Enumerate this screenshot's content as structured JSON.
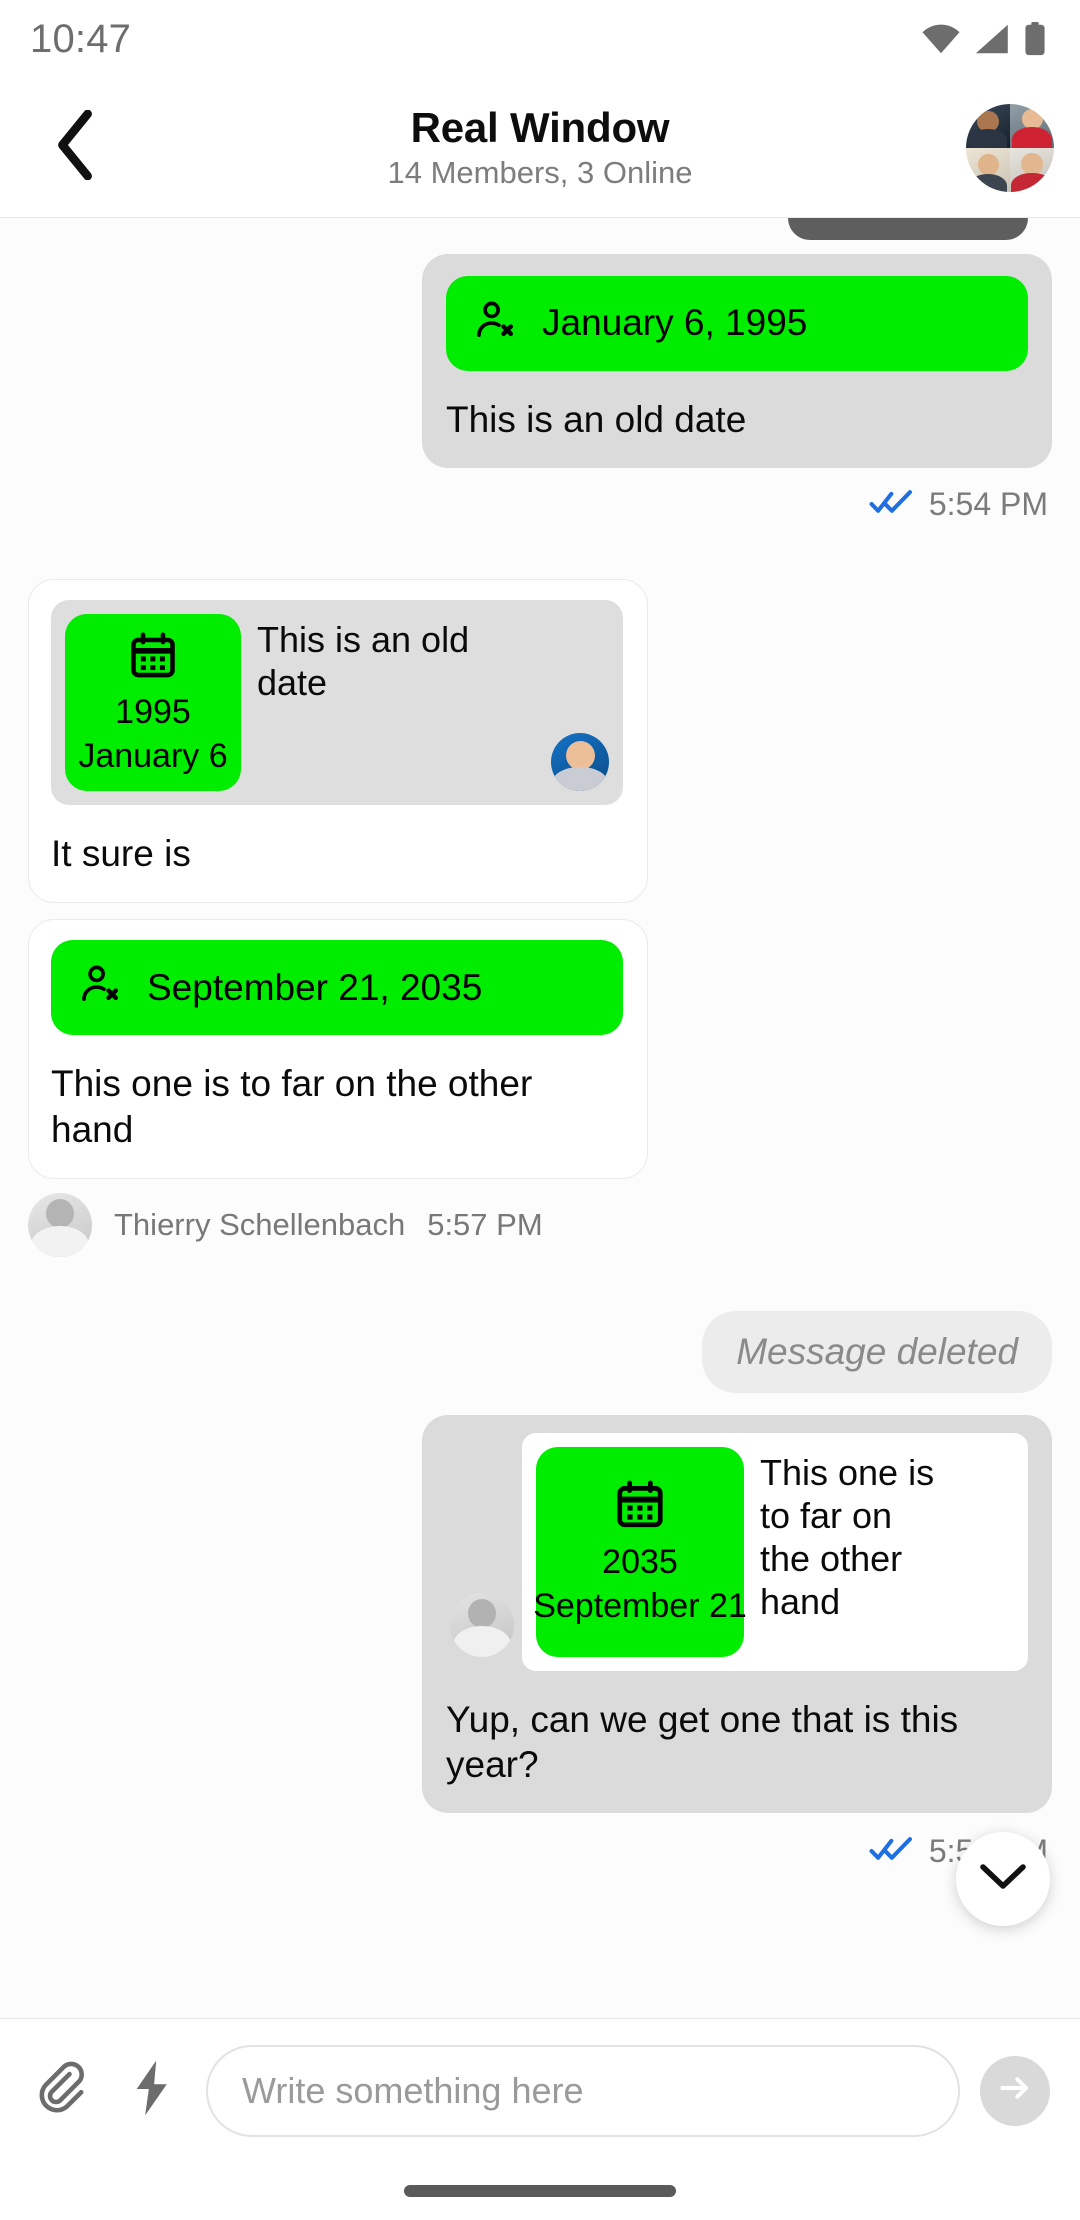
{
  "status_bar": {
    "time": "10:47",
    "icons": [
      "wifi-icon",
      "cellular-icon",
      "battery-icon"
    ]
  },
  "header": {
    "back_icon": "chevron-left-icon",
    "title": "Real Window",
    "subtitle": "14 Members, 3 Online",
    "avatar_name": "group-avatar"
  },
  "messages": [
    {
      "id": "partial-top",
      "side": "right",
      "kind": "partial-bubble"
    },
    {
      "id": "msg-1",
      "side": "right",
      "kind": "attachment",
      "attachment": {
        "icon": "person-remove-icon",
        "label": "January 6, 1995",
        "color": "#00ed00"
      },
      "text": "This is an old date",
      "receipt": "double-check-icon",
      "time": "5:54 PM"
    },
    {
      "id": "msg-2",
      "side": "left",
      "kind": "quote-reply",
      "quote": {
        "calendar_icon": "calendar-icon",
        "year": "1995",
        "day": "January 6",
        "text": "This is an old date",
        "avatar": "quoted-author-avatar"
      },
      "text": "It sure is"
    },
    {
      "id": "msg-3",
      "side": "left",
      "kind": "attachment",
      "attachment": {
        "icon": "person-remove-icon",
        "label": "September 21, 2035",
        "color": "#00ed00"
      },
      "text": "This one is to far on the other hand",
      "sender": "Thierry Schellenbach",
      "time": "5:57 PM"
    },
    {
      "id": "msg-4",
      "side": "right",
      "kind": "deleted",
      "text": "Message deleted"
    },
    {
      "id": "msg-5",
      "side": "right",
      "kind": "quote-reply",
      "quote": {
        "calendar_icon": "calendar-icon",
        "year": "2035",
        "day": "September 21",
        "text": "This one is to far on the other hand",
        "avatar": "quoted-author-avatar"
      },
      "text": "Yup, can we get one that is this year?",
      "receipt": "double-check-icon",
      "time": "5:59 PM"
    }
  ],
  "scroll_button": {
    "icon": "chevron-down-icon"
  },
  "composer": {
    "attach_icon": "paperclip-icon",
    "command_icon": "lightning-bolt-icon",
    "placeholder": "Write something here",
    "value": "",
    "send_icon": "arrow-right-icon"
  },
  "colors": {
    "accent_green": "#00ed00",
    "receipt_blue": "#1f6fe0",
    "bubble_out": "#dbdbdb",
    "bubble_in": "#ffffff",
    "deleted_bg": "#ececec"
  }
}
